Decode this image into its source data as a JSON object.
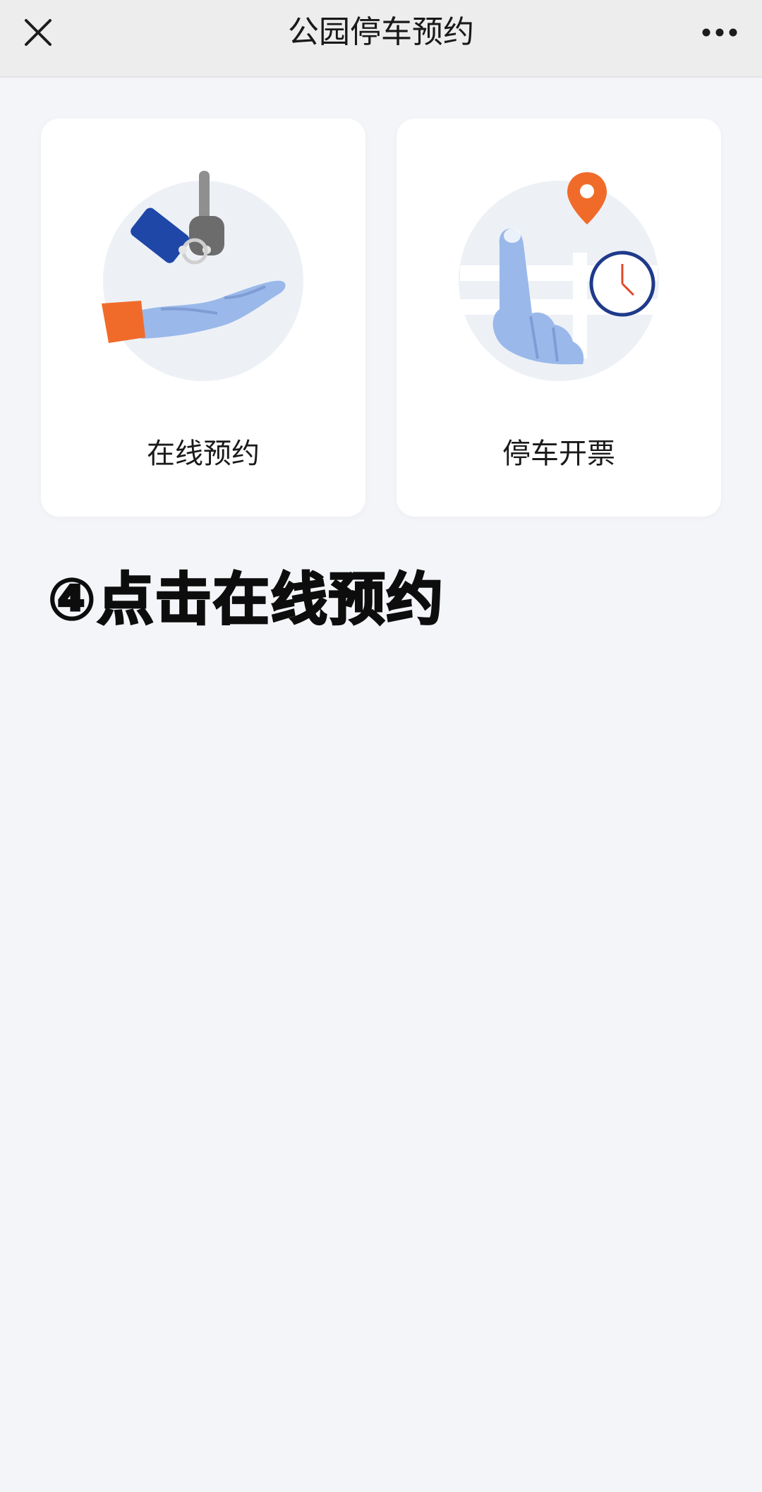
{
  "header": {
    "title": "公园停车预约",
    "close_icon": "close-icon",
    "more_icon": "more-dots-icon"
  },
  "cards": [
    {
      "label": "在线预约",
      "icon": "hand-with-keys-illustration"
    },
    {
      "label": "停车开票",
      "icon": "finger-location-clock-illustration"
    }
  ],
  "instruction": {
    "text": "④点击在线预约"
  },
  "colors": {
    "page_background": "#f3f5f8",
    "header_background": "#ededed",
    "accent_orange": "#f06b2a",
    "accent_blue": "#1f47a8",
    "illustration_blue": "#9ab8ea"
  }
}
